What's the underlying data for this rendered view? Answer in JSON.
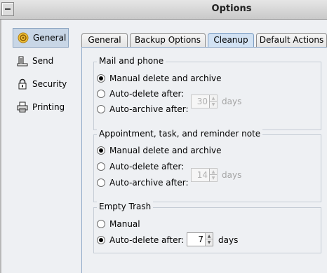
{
  "window": {
    "title": "Options"
  },
  "sidebar": {
    "items": [
      {
        "label": "General",
        "icon": "general-icon",
        "active": true
      },
      {
        "label": "Send",
        "icon": "send-icon"
      },
      {
        "label": "Security",
        "icon": "lock-icon"
      },
      {
        "label": "Printing",
        "icon": "printer-icon"
      }
    ]
  },
  "tabs": [
    {
      "label": "General"
    },
    {
      "label": "Backup Options"
    },
    {
      "label": "Cleanup",
      "active": true
    },
    {
      "label": "Default Actions"
    }
  ],
  "mail_phone": {
    "title": "Mail and phone",
    "manual": "Manual delete and archive",
    "auto_delete": "Auto-delete after:",
    "auto_archive": "Auto-archive after:",
    "days_value": "30",
    "days_unit": "days",
    "selected": "manual"
  },
  "appointment": {
    "title": "Appointment, task, and reminder note",
    "manual": "Manual delete and archive",
    "auto_delete": "Auto-delete after:",
    "auto_archive": "Auto-archive after:",
    "days_value": "14",
    "days_unit": "days",
    "selected": "manual"
  },
  "trash": {
    "title": "Empty Trash",
    "manual": "Manual",
    "auto_delete": "Auto-delete after:",
    "days_value": "7",
    "days_unit": "days",
    "selected": "auto_delete"
  },
  "colors": {
    "accent": "#d2e2f3",
    "panel_bg": "#eef0f3",
    "active_sidebar": "#c8d6e6"
  }
}
